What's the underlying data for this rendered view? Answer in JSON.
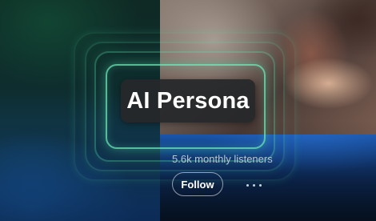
{
  "artist": {
    "name": "AI Persona",
    "monthly_listeners": "5.6k monthly listeners"
  },
  "actions": {
    "follow_label": "Follow",
    "more_icon": "more-options-icon"
  },
  "colors": {
    "glow_accent": "#6eebb9",
    "title_box": "#26282a",
    "listeners_text": "#b9c6d2"
  }
}
